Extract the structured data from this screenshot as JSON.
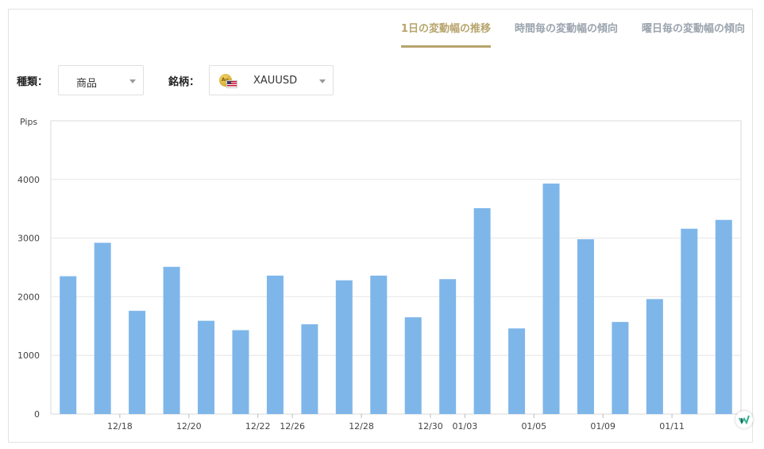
{
  "tabs": [
    {
      "label": "1日の変動幅の推移",
      "active": true
    },
    {
      "label": "時間毎の変動幅の傾向",
      "active": false
    },
    {
      "label": "曜日毎の変動幅の傾向",
      "active": false
    }
  ],
  "filters": {
    "type_label": "種類：",
    "type_value": "商品",
    "symbol_label": "銘柄：",
    "symbol_value": "XAUUSD",
    "symbol_icon": "gold-coin-usd-flag-icon"
  },
  "colors": {
    "bar": "#7eb6ea",
    "accent": "#b7a46d",
    "tab_inactive": "#9aa3ad"
  },
  "chart_data": {
    "type": "bar",
    "ylabel": "Pips",
    "ylim": [
      0,
      5000
    ],
    "yticks": [
      0,
      1000,
      2000,
      3000,
      4000
    ],
    "grid": true,
    "xtick_labels": [
      "12/18",
      "12/20",
      "12/22",
      "12/26",
      "12/28",
      "12/30",
      "01/03",
      "01/05",
      "01/09",
      "01/11"
    ],
    "xtick_bar_boundaries": [
      2,
      4,
      6,
      7,
      9,
      11,
      12,
      14,
      16,
      18
    ],
    "values": [
      2350,
      2920,
      1760,
      2510,
      1590,
      1430,
      2360,
      1530,
      2280,
      2360,
      1650,
      2300,
      3510,
      1460,
      3930,
      2980,
      1570,
      1960,
      3160,
      3310
    ]
  }
}
